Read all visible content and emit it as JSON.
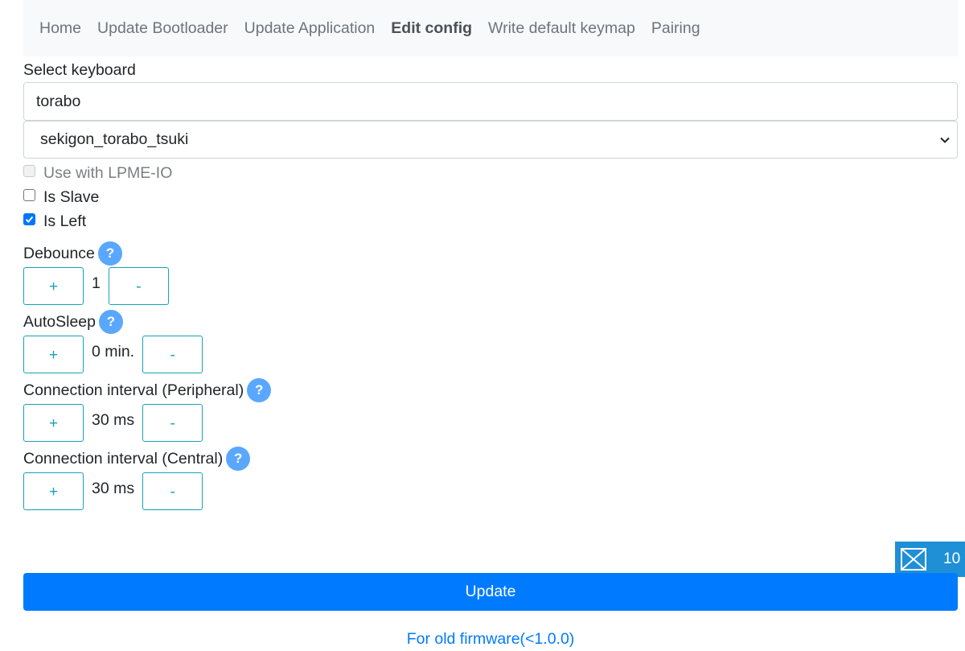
{
  "nav": {
    "items": [
      {
        "label": "Home"
      },
      {
        "label": "Update Bootloader"
      },
      {
        "label": "Update Application"
      },
      {
        "label": "Edit config"
      },
      {
        "label": "Write default keymap"
      },
      {
        "label": "Pairing"
      }
    ],
    "active_index": 3
  },
  "keyboard": {
    "label": "Select keyboard",
    "search_value": "torabo",
    "selected": "sekigon_torabo_tsuki"
  },
  "options": {
    "lpme": {
      "label": "Use with LPME-IO",
      "checked": false,
      "disabled": true
    },
    "slave": {
      "label": "Is Slave",
      "checked": false
    },
    "left": {
      "label": "Is Left",
      "checked": true
    }
  },
  "fields": {
    "debounce": {
      "label": "Debounce",
      "value": "1",
      "plus": "+",
      "minus": "-",
      "help": "?"
    },
    "autosleep": {
      "label": "AutoSleep",
      "value": "0 min.",
      "plus": "+",
      "minus": "-",
      "help": "?"
    },
    "peripheral": {
      "label": "Connection interval (Peripheral)",
      "value": "30 ms",
      "plus": "+",
      "minus": "-",
      "help": "?"
    },
    "central": {
      "label": "Connection interval (Central)",
      "value": "30 ms",
      "plus": "+",
      "minus": "-",
      "help": "?"
    }
  },
  "actions": {
    "update_label": "Update",
    "old_firmware_label": "For old firmware(<1.0.0)"
  },
  "badge": {
    "icon": "envelope-x-icon",
    "count": "10"
  },
  "colors": {
    "primary": "#007bff",
    "info": "#17a2b8",
    "help": "#5aa7ff",
    "badge": "#1f8fd6"
  }
}
